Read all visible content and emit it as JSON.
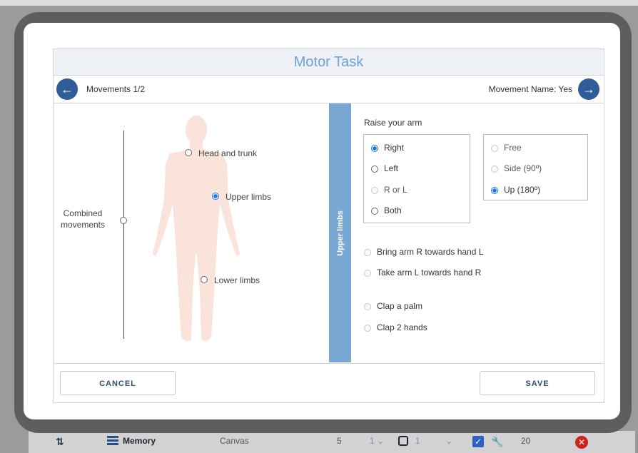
{
  "background_app": {
    "sort_icon": "sort-arrows-icon",
    "list_icon": "list-icon",
    "memory_label": "Memory",
    "canvas_label": "Canvas",
    "count": "5",
    "select_a": "1 ⌄",
    "select_b": "1",
    "chevron": "⌄",
    "value": "20"
  },
  "dialog": {
    "title": "Motor Task",
    "nav": {
      "counter": "Movements 1/2",
      "movement_name": "Movement Name: Yes",
      "prev_icon": "arrow-left-icon",
      "next_icon": "arrow-right-icon"
    },
    "body_parts": {
      "combined": [
        "Combined",
        "movements"
      ],
      "head_trunk": "Head and trunk",
      "upper_limbs": "Upper limbs",
      "lower_limbs": "Lower limbs",
      "selected": "Upper limbs"
    },
    "section_tab": "Upper limbs",
    "movement": {
      "heading": "Raise your arm",
      "side_options": [
        {
          "label": "Right",
          "state": "checked"
        },
        {
          "label": "Left",
          "state": "enabled"
        },
        {
          "label": "R or L",
          "state": "disabled"
        },
        {
          "label": "Both",
          "state": "enabled"
        }
      ],
      "mode_options": [
        {
          "label": "Free",
          "state": "disabled"
        },
        {
          "label": "Side (90º)",
          "state": "disabled"
        },
        {
          "label": "Up (180º)",
          "state": "checked"
        }
      ],
      "other_movements": [
        "Bring arm R towards hand L",
        "Take arm L towards hand R",
        "Clap a palm",
        "Clap 2 hands"
      ]
    },
    "buttons": {
      "cancel": "CANCEL",
      "save": "SAVE"
    }
  },
  "colors": {
    "title_text": "#6fa1d2",
    "nav_button": "#2f5d97",
    "section_tab": "#7aa8d4",
    "silhouette": "#f9e3da",
    "radio_checked": "#1a73e8"
  }
}
